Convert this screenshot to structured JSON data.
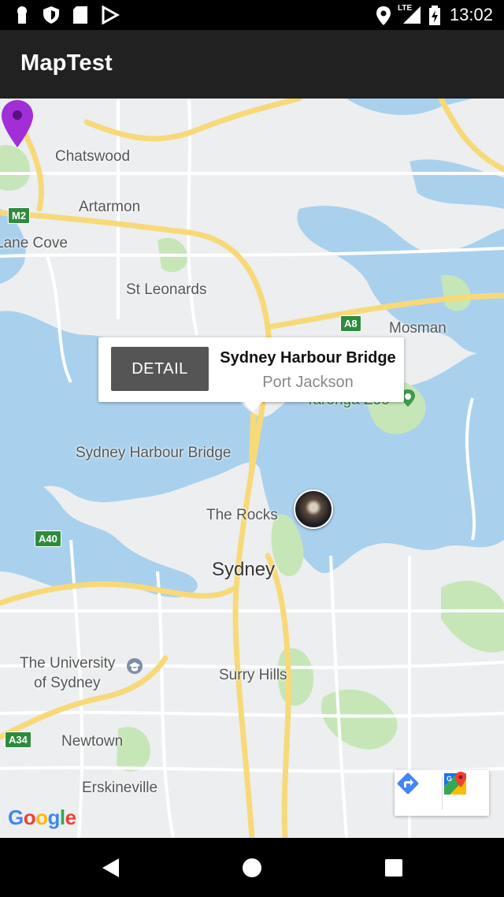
{
  "status_bar": {
    "time": "13:02",
    "network": "LTE",
    "icons": [
      "keyhole-icon",
      "shield-icon",
      "sd-card-icon",
      "play-store-icon",
      "location-icon",
      "signal-icon",
      "battery-icon"
    ]
  },
  "app_bar": {
    "title": "MapTest"
  },
  "map": {
    "labels": {
      "chatswood": "Chatswood",
      "artarmon": "Artarmon",
      "lane_cove": "Lane Cove",
      "st_leonards": "St Leonards",
      "mosman": "Mosman",
      "taronga": "Taronga Zoo",
      "harbour_bridge": "Sydney Harbour Bridge",
      "the_rocks": "The Rocks",
      "sydney": "Sydney",
      "university": "The University",
      "university_2": "of Sydney",
      "surry_hills": "Surry Hills",
      "newtown": "Newtown",
      "erskineville": "Erskineville"
    },
    "shields": {
      "m2": "M2",
      "a8": "A8",
      "a40": "A40",
      "a34": "A34"
    },
    "info_window": {
      "button_label": "DETAIL",
      "title": "Sydney Harbour Bridge",
      "subtitle": "Port Jackson"
    },
    "google_logo": "Google",
    "colors": {
      "water": "#a9d1ee",
      "park": "#c6e6b8",
      "road_major": "#f8d979",
      "land": "#eceef0",
      "marker": "#a22ed8"
    }
  },
  "nav_bar": {
    "icons": [
      "back-icon",
      "home-icon",
      "recents-icon"
    ]
  }
}
